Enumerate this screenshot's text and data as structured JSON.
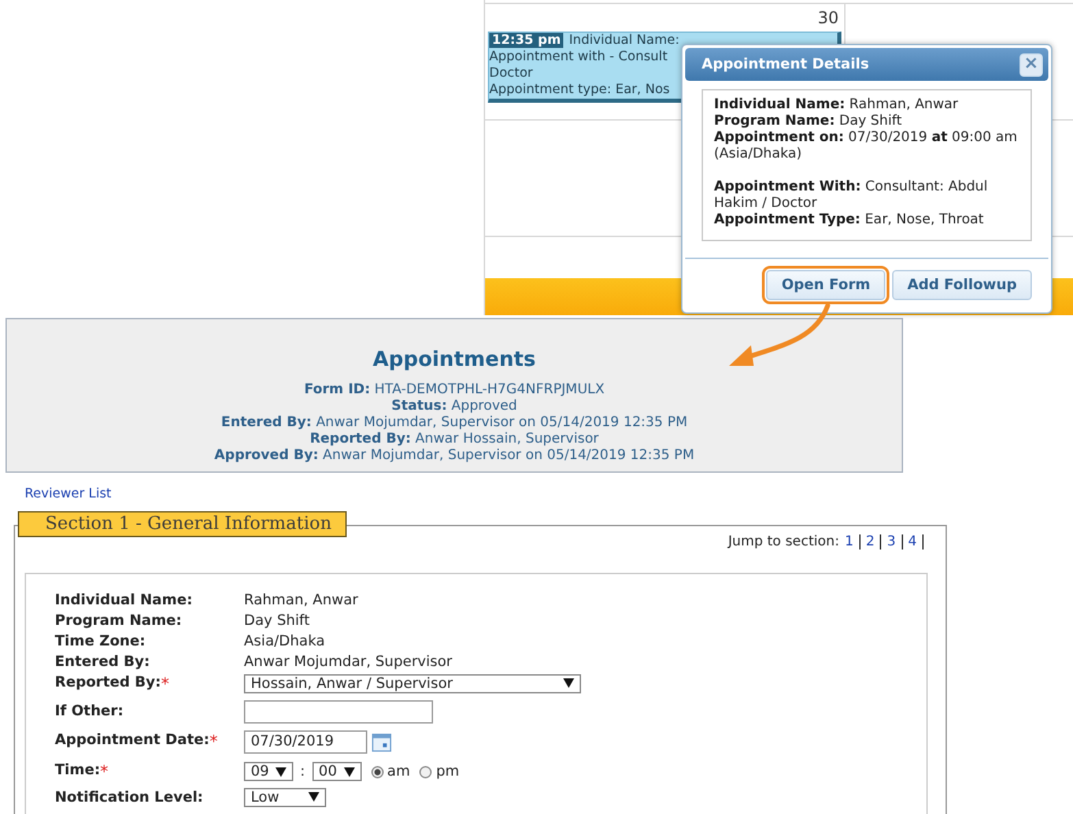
{
  "calendar": {
    "day": "30",
    "event": {
      "time": "12:35 pm",
      "lines": [
        "Individual Name:",
        "Appointment with - Consult",
        "Doctor",
        "Appointment type: Ear, Nos"
      ]
    }
  },
  "popup": {
    "title": "Appointment Details",
    "close": "×",
    "detail_groups": [
      [
        {
          "parts": [
            {
              "label": "Individual Name:",
              "value": "Rahman, Anwar"
            }
          ]
        },
        {
          "parts": [
            {
              "label": "Program Name:",
              "value": "Day Shift"
            }
          ]
        },
        {
          "parts": [
            {
              "label": "Appointment on:",
              "value": "07/30/2019"
            },
            {
              "label": "at",
              "value": "09:00 am (Asia/Dhaka)"
            }
          ]
        }
      ],
      [
        {
          "parts": [
            {
              "label": "Appointment With:",
              "value": "Consultant: Abdul Hakim / Doctor"
            }
          ]
        },
        {
          "parts": [
            {
              "label": "Appointment Type:",
              "value": "Ear, Nose, Throat"
            }
          ]
        }
      ]
    ],
    "buttons": [
      {
        "label": "Open Form",
        "highlighted": true
      },
      {
        "label": "Add Followup",
        "highlighted": false
      }
    ]
  },
  "header": {
    "title": "Appointments",
    "rows": [
      {
        "label": "Form ID:",
        "value": "HTA-DEMOTPHL-H7G4NFRPJMULX"
      },
      {
        "label": "Status:",
        "value": "Approved"
      },
      {
        "label": "Entered By:",
        "value": "Anwar Mojumdar, Supervisor  on 05/14/2019 12:35 PM"
      },
      {
        "label": "Reported By:",
        "value": "Anwar Hossain, Supervisor"
      },
      {
        "label": "Approved By:",
        "value": "Anwar Mojumdar, Supervisor  on 05/14/2019 12:35 PM"
      }
    ]
  },
  "reviewer_link": "Reviewer List",
  "section": {
    "title": "Section 1 - General Information",
    "jump_label": "Jump to section:",
    "jump_links": [
      "1",
      "2",
      "3",
      "4"
    ],
    "fields": [
      {
        "kind": "text",
        "label": "Individual Name:",
        "value": "Rahman, Anwar"
      },
      {
        "kind": "text",
        "label": "Program Name:",
        "value": "Day Shift"
      },
      {
        "kind": "text",
        "label": "Time Zone:",
        "value": "Asia/Dhaka"
      },
      {
        "kind": "text",
        "label": "Entered By:",
        "value": "Anwar Mojumdar, Supervisor"
      },
      {
        "kind": "wide_select",
        "label": "Reported By:",
        "required_mark": "*",
        "value": "Hossain, Anwar / Supervisor"
      },
      {
        "kind": "input",
        "label": "If Other:"
      },
      {
        "kind": "date",
        "label": "Appointment Date:",
        "required_mark": "*",
        "value": "07/30/2019"
      },
      {
        "kind": "time",
        "label": "Time:",
        "required_mark": "*",
        "hour": "09",
        "separator": ":",
        "minute": "00",
        "periods": [
          {
            "label": "am",
            "selected": true
          },
          {
            "label": "pm",
            "selected": false
          }
        ]
      },
      {
        "kind": "select",
        "label": "Notification Level:",
        "value": "Low"
      }
    ]
  }
}
